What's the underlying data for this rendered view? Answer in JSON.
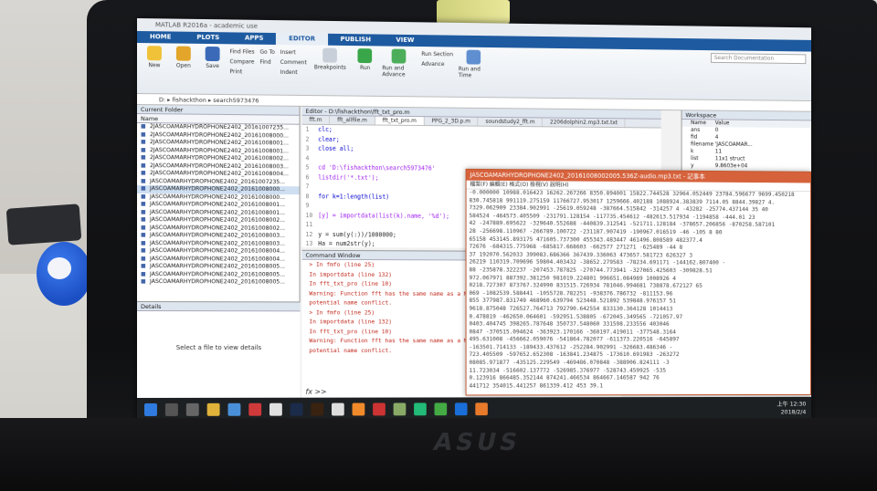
{
  "scene": {
    "laptop_brand": "ASUS",
    "sticker_text": ""
  },
  "matlab": {
    "window_title": "MATLAB R2016a - academic use",
    "tabs": [
      "HOME",
      "PLOTS",
      "APPS",
      "EDITOR",
      "PUBLISH",
      "VIEW"
    ],
    "ribbon": {
      "buttons": [
        "New",
        "Open",
        "Save",
        "Find Files",
        "Compare",
        "Print",
        "Go To",
        "Find",
        "Insert",
        "Comment",
        "Indent",
        "Breakpoints",
        "Run",
        "Run and Advance",
        "Run Section",
        "Advance",
        "Run and Time"
      ],
      "search_placeholder": "Search Documentation"
    },
    "address": "D: ▸ fishackthon ▸ search5973476",
    "current_folder_title": "Current Folder",
    "column_name": "Name",
    "files": [
      "2JASCOAMARHYDROPHONE2402_20161007235...",
      "2JASCOAMARHYDROPHONE2402_20161008000...",
      "2JASCOAMARHYDROPHONE2402_20161008001...",
      "2JASCOAMARHYDROPHONE2402_20161008001...",
      "2JASCOAMARHYDROPHONE2402_20161008002...",
      "2JASCOAMARHYDROPHONE2402_20161008003...",
      "2JASCOAMARHYDROPHONE2402_20161008004...",
      "JASCOAMARHYDROPHONE2402_20161007235...",
      "JASCOAMARHYDROPHONE2402_20161008000...",
      "JASCOAMARHYDROPHONE2402_20161008000...",
      "JASCOAMARHYDROPHONE2402_20161008001...",
      "JASCOAMARHYDROPHONE2402_20161008001...",
      "JASCOAMARHYDROPHONE2402_20161008002...",
      "JASCOAMARHYDROPHONE2402_20161008002...",
      "JASCOAMARHYDROPHONE2402_20161008003...",
      "JASCOAMARHYDROPHONE2402_20161008003...",
      "JASCOAMARHYDROPHONE2402_20161008004...",
      "JASCOAMARHYDROPHONE2402_20161008004...",
      "JASCOAMARHYDROPHONE2402_20161008005...",
      "JASCOAMARHYDROPHONE2402_20161008005...",
      "JASCOAMARHYDROPHONE2402_20161008005..."
    ],
    "details_title": "Details",
    "details_message": "Select a file to view details",
    "editor_title": "Editor - D:\\fishackthon\\fft_txt_pro.m",
    "editor_tabs": [
      "fft.m",
      "fft_allfile.m",
      "fft_txt_pro.m",
      "PPG_2_3D.p.m",
      "soundstudy2_fft.m",
      "2206dolphin2.mp3.txt.txt"
    ],
    "code_lines": [
      {
        "n": "1",
        "text": "clc;"
      },
      {
        "n": "2",
        "text": "clear;"
      },
      {
        "n": "3",
        "text": "close all;"
      },
      {
        "n": "4",
        "text": ""
      },
      {
        "n": "5",
        "text": "cd 'D:\\fishackthon\\search5973476'"
      },
      {
        "n": "6",
        "text": "listdir('*.txt');"
      },
      {
        "n": "7",
        "text": ""
      },
      {
        "n": "8",
        "text": "for k=1:length(list)"
      },
      {
        "n": "9",
        "text": ""
      },
      {
        "n": "10",
        "text": "[y] = importdata(list(k).name, '%d');"
      },
      {
        "n": "11",
        "text": ""
      },
      {
        "n": "12",
        "text": "y = sum(y(:))/1000000;"
      },
      {
        "n": "13",
        "text": "Ha = num2str(y);"
      }
    ],
    "command_window_title": "Command Window",
    "command_lines": [
      "> In fmfo (line 25)",
      "In importdata (line 132)",
      "In fft_txt_pro (line 10)",
      "Warning: Function fft has the same name as a MATLAB builtin.",
      "potential name conflict.",
      "> In fmfo (line 25)",
      "In importdata (line 132)",
      "In fft_txt_pro (line 10)",
      "Warning: Function fft has the same name as a MATLAB builtin.",
      "potential name conflict."
    ],
    "prompt": "fx >>",
    "workspace_title": "Workspace",
    "workspace_header": [
      "Name",
      "Value"
    ],
    "workspace_rows": [
      [
        "ans",
        "0"
      ],
      [
        "fid",
        "4"
      ],
      [
        "filename",
        "'JASCOAMAR..."
      ],
      [
        "k",
        "11"
      ],
      [
        "list",
        "11x1 struct"
      ],
      [
        "y",
        "9.8603e+04"
      ]
    ]
  },
  "notepad": {
    "title": "JASCOAMARHYDROPHONE2402_20161008002005.536Z-audio.mp3.txt - 記事本",
    "menu": "檔案(F)  編輯(E)  格式(O)  檢視(V)  說明(H)",
    "lines": [
      "-0.000000 10988.016423 16262.267266 8350.894001 15822.744528 32964.052449 23784.596677 9699.450218",
      "830.745818 991119.275159 11766727.953017 1259666.402188 1088924.383839 7114.05 8844.39827 4.",
      "7329.062909 23384.902991 -25619.059248 -387664.515842 -314257 4 -43282 -25774.437144 35 40",
      "584524 -464573.405509 -231791.128154 -117735.454612 -482613.517934 -1194858 -444.01 23",
      "42 -247889.695622 -329640.552688 -440839.312541 -521711.128184 -378657.206856 -870258.587101",
      "28 -256698.110967 -266789.100722 -231187.907419 -190967.016519 -46 -105 8 80",
      "65158 453145.893175 471605.737300 455343.483447 461496.808589 482377.4",
      "72676 -684315.775968 -685817.668603 -662577 271271 -625489 -44 8",
      "37 192070.562033 399083.686366 367439.336063 473657.581723 626327 3",
      "26219 110319.709696 59804.403432 -38652.279583 -78234.691171 -144162.807400 -",
      "88 -235878.322237 -207453.787825 -270744.773941 -327065.425603 -309828.51",
      "972.067971 887392.381250 981019.224801 996651.084989 1008926 4",
      "0218.727307 873767.324990 831515.726934 781046.994681 738878.672127 65",
      "069 -1082539.588441 -1055728.782251 -938376.786732 -811153.96",
      "855 377987.831749 468960.639794 523448.521892 539848.976157 51",
      "9618.875048 726527.764713 792790.642554 833130.364128 1014413",
      "0.478819 -462650.064601 -592951.538805 -672045.349565 -721057.97",
      "0403.404745 398265.787648 350737.548060 331598.233556 403046",
      "0847 -370515.094624 -363923.170166 -360197.419011 -377548.3164",
      "495.631008 -456662.059076 -541864.782077 -611373.220516 -645897",
      "-163501.714133 -189433.437612 -252284.902991 -326683.486346 -",
      "723.405509 -597652.652308 -163841.234875 -173610.691983 -263272",
      "08085.971877 -435125.229549 -469486.070848 -388906.824111 -3",
      "11.723034 -516602.137772 -526985.376977 -528743.459925 -535",
      "0.123916 866485.352144 874241.466534 864667.146587 942 76",
      "441712 354015.441257 861339.412 453 39.1"
    ]
  },
  "taskbar": {
    "time": "上午 12:30",
    "date": "2018/2/4"
  }
}
